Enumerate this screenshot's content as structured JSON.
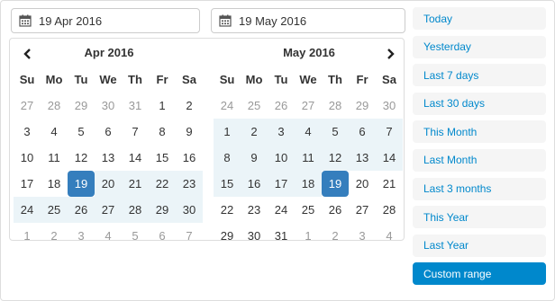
{
  "inputs": {
    "start_value": "19 Apr 2016",
    "end_value": "19 May 2016"
  },
  "icons": {
    "calendar": "calendar-icon",
    "prev": "chevron-left-icon",
    "next": "chevron-right-icon"
  },
  "colors": {
    "accent": "#357ebd",
    "range_bg": "#ebf4f8",
    "link": "#0088cc",
    "active_range": "#0088cc"
  },
  "left_calendar": {
    "title": "Apr 2016",
    "weekdays": [
      "Su",
      "Mo",
      "Tu",
      "We",
      "Th",
      "Fr",
      "Sa"
    ],
    "weeks": [
      [
        {
          "d": "27",
          "off": true
        },
        {
          "d": "28",
          "off": true
        },
        {
          "d": "29",
          "off": true
        },
        {
          "d": "30",
          "off": true
        },
        {
          "d": "31",
          "off": true
        },
        {
          "d": "1"
        },
        {
          "d": "2"
        }
      ],
      [
        {
          "d": "3"
        },
        {
          "d": "4"
        },
        {
          "d": "5"
        },
        {
          "d": "6"
        },
        {
          "d": "7"
        },
        {
          "d": "8"
        },
        {
          "d": "9"
        }
      ],
      [
        {
          "d": "10"
        },
        {
          "d": "11"
        },
        {
          "d": "12"
        },
        {
          "d": "13"
        },
        {
          "d": "14"
        },
        {
          "d": "15"
        },
        {
          "d": "16"
        }
      ],
      [
        {
          "d": "17"
        },
        {
          "d": "18"
        },
        {
          "d": "19",
          "active": true
        },
        {
          "d": "20",
          "range": true
        },
        {
          "d": "21",
          "range": true
        },
        {
          "d": "22",
          "range": true
        },
        {
          "d": "23",
          "range": true
        }
      ],
      [
        {
          "d": "24",
          "range": true
        },
        {
          "d": "25",
          "range": true
        },
        {
          "d": "26",
          "range": true
        },
        {
          "d": "27",
          "range": true
        },
        {
          "d": "28",
          "range": true
        },
        {
          "d": "29",
          "range": true
        },
        {
          "d": "30",
          "range": true
        }
      ],
      [
        {
          "d": "1",
          "off": true
        },
        {
          "d": "2",
          "off": true
        },
        {
          "d": "3",
          "off": true
        },
        {
          "d": "4",
          "off": true
        },
        {
          "d": "5",
          "off": true
        },
        {
          "d": "6",
          "off": true
        },
        {
          "d": "7",
          "off": true
        }
      ]
    ]
  },
  "right_calendar": {
    "title": "May 2016",
    "weekdays": [
      "Su",
      "Mo",
      "Tu",
      "We",
      "Th",
      "Fr",
      "Sa"
    ],
    "weeks": [
      [
        {
          "d": "24",
          "off": true
        },
        {
          "d": "25",
          "off": true
        },
        {
          "d": "26",
          "off": true
        },
        {
          "d": "27",
          "off": true
        },
        {
          "d": "28",
          "off": true
        },
        {
          "d": "29",
          "off": true
        },
        {
          "d": "30",
          "off": true
        }
      ],
      [
        {
          "d": "1",
          "range": true
        },
        {
          "d": "2",
          "range": true
        },
        {
          "d": "3",
          "range": true
        },
        {
          "d": "4",
          "range": true
        },
        {
          "d": "5",
          "range": true
        },
        {
          "d": "6",
          "range": true
        },
        {
          "d": "7",
          "range": true
        }
      ],
      [
        {
          "d": "8",
          "range": true
        },
        {
          "d": "9",
          "range": true
        },
        {
          "d": "10",
          "range": true
        },
        {
          "d": "11",
          "range": true
        },
        {
          "d": "12",
          "range": true
        },
        {
          "d": "13",
          "range": true
        },
        {
          "d": "14",
          "range": true
        }
      ],
      [
        {
          "d": "15",
          "range": true
        },
        {
          "d": "16",
          "range": true
        },
        {
          "d": "17",
          "range": true
        },
        {
          "d": "18",
          "range": true
        },
        {
          "d": "19",
          "active": true
        },
        {
          "d": "20"
        },
        {
          "d": "21"
        }
      ],
      [
        {
          "d": "22"
        },
        {
          "d": "23"
        },
        {
          "d": "24"
        },
        {
          "d": "25"
        },
        {
          "d": "26"
        },
        {
          "d": "27"
        },
        {
          "d": "28"
        }
      ],
      [
        {
          "d": "29"
        },
        {
          "d": "30"
        },
        {
          "d": "31"
        },
        {
          "d": "1",
          "off": true
        },
        {
          "d": "2",
          "off": true
        },
        {
          "d": "3",
          "off": true
        },
        {
          "d": "4",
          "off": true
        }
      ]
    ]
  },
  "ranges": [
    {
      "label": "Today",
      "active": false
    },
    {
      "label": "Yesterday",
      "active": false
    },
    {
      "label": "Last 7 days",
      "active": false
    },
    {
      "label": "Last 30 days",
      "active": false
    },
    {
      "label": "This Month",
      "active": false
    },
    {
      "label": "Last Month",
      "active": false
    },
    {
      "label": "Last 3 months",
      "active": false
    },
    {
      "label": "This Year",
      "active": false
    },
    {
      "label": "Last Year",
      "active": false
    },
    {
      "label": "Custom range",
      "active": true
    }
  ]
}
